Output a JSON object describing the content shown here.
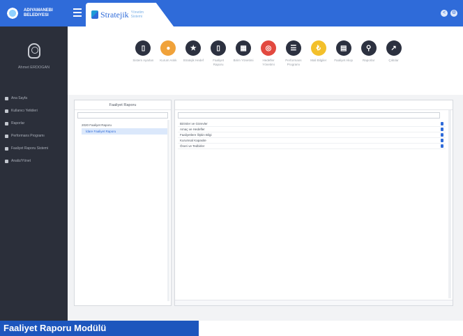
{
  "sidebar": {
    "brand_line1": "ADIYAMANEBI",
    "brand_line2": "BELEDIYESI",
    "user_name": "Ahmet ERDOGAN",
    "items": [
      {
        "label": "Ana Sayfa"
      },
      {
        "label": "Kullanıcı Yetkileri"
      },
      {
        "label": "Raporlar"
      },
      {
        "label": "Performans Programı"
      },
      {
        "label": "Faaliyet Raporu Sistemi"
      },
      {
        "label": "Analiz/Yönet"
      }
    ]
  },
  "topbar": {
    "logo_title": "Stratejik",
    "logo_subtitle": "Yönetim Sistemi"
  },
  "modules": [
    {
      "label": "Sistem Ayarları",
      "color": "#2c3140"
    },
    {
      "label": "Kurum Anlık",
      "color": "#f0a23a"
    },
    {
      "label": "Stratejik Hedef",
      "color": "#2c3140"
    },
    {
      "label": "Faaliyet Raporu",
      "color": "#2c3140"
    },
    {
      "label": "Birim Yönetimi",
      "color": "#2c3140"
    },
    {
      "label": "Hedefler Yönetimi",
      "color": "#e2493f"
    },
    {
      "label": "Performans Programı",
      "color": "#2c3140"
    },
    {
      "label": "Mali Bilgiler",
      "color": "#f3c02b"
    },
    {
      "label": "Faaliyet Akışı",
      "color": "#2c3140"
    },
    {
      "label": "Raporlar",
      "color": "#2c3140"
    },
    {
      "label": "Çıktılar",
      "color": "#2c3140"
    }
  ],
  "left_panel": {
    "title": "Faaliyet Raporu",
    "tree": [
      {
        "label": "2020 Faaliyet Raporu"
      },
      {
        "label": "İdare Faaliyet Raporu"
      }
    ]
  },
  "right_panel": {
    "rows": [
      {
        "label": "Birimler ve Görevler"
      },
      {
        "label": "Amaç ve Hedefler"
      },
      {
        "label": "Faaliyetlere İlişkin Bilgi"
      },
      {
        "label": "Kurumsal Kapasite"
      },
      {
        "label": "Öneri ve Tedbirler"
      }
    ]
  },
  "caption": "Faaliyet Raporu Modülü"
}
